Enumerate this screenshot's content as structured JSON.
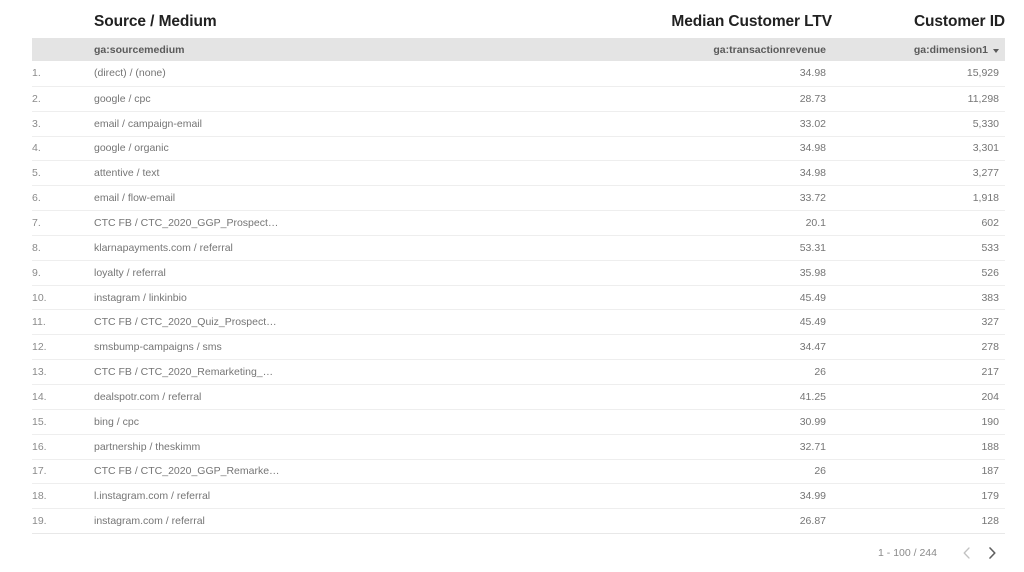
{
  "table": {
    "columns": [
      {
        "title": "",
        "field": ""
      },
      {
        "title": "Source / Medium",
        "field": "ga:sourcemedium"
      },
      {
        "title": "Median Customer LTV",
        "field": "ga:transactionrevenue"
      },
      {
        "title": "Customer ID",
        "field": "ga:dimension1"
      }
    ],
    "sorted_column_index": 3,
    "sort_icon": "caret-down-icon",
    "rows": [
      {
        "index": "1.",
        "source_medium": "(direct) / (none)",
        "median_ltv": "34.98",
        "customer_id": "15,929"
      },
      {
        "index": "2.",
        "source_medium": "google / cpc",
        "median_ltv": "28.73",
        "customer_id": "11,298"
      },
      {
        "index": "3.",
        "source_medium": "email / campaign-email",
        "median_ltv": "33.02",
        "customer_id": "5,330"
      },
      {
        "index": "4.",
        "source_medium": "google / organic",
        "median_ltv": "34.98",
        "customer_id": "3,301"
      },
      {
        "index": "5.",
        "source_medium": "attentive / text",
        "median_ltv": "34.98",
        "customer_id": "3,277"
      },
      {
        "index": "6.",
        "source_medium": "email / flow-email",
        "median_ltv": "33.72",
        "customer_id": "1,918"
      },
      {
        "index": "7.",
        "source_medium": "CTC FB / CTC_2020_GGP_Prospect…",
        "median_ltv": "20.1",
        "customer_id": "602"
      },
      {
        "index": "8.",
        "source_medium": "klarnapayments.com / referral",
        "median_ltv": "53.31",
        "customer_id": "533"
      },
      {
        "index": "9.",
        "source_medium": "loyalty / referral",
        "median_ltv": "35.98",
        "customer_id": "526"
      },
      {
        "index": "10.",
        "source_medium": "instagram / linkinbio",
        "median_ltv": "45.49",
        "customer_id": "383"
      },
      {
        "index": "11.",
        "source_medium": "CTC FB / CTC_2020_Quiz_Prospect…",
        "median_ltv": "45.49",
        "customer_id": "327"
      },
      {
        "index": "12.",
        "source_medium": "smsbump-campaigns / sms",
        "median_ltv": "34.47",
        "customer_id": "278"
      },
      {
        "index": "13.",
        "source_medium": "CTC FB / CTC_2020_Remarketing_…",
        "median_ltv": "26",
        "customer_id": "217"
      },
      {
        "index": "14.",
        "source_medium": "dealspotr.com / referral",
        "median_ltv": "41.25",
        "customer_id": "204"
      },
      {
        "index": "15.",
        "source_medium": "bing / cpc",
        "median_ltv": "30.99",
        "customer_id": "190"
      },
      {
        "index": "16.",
        "source_medium": "partnership / theskimm",
        "median_ltv": "32.71",
        "customer_id": "188"
      },
      {
        "index": "17.",
        "source_medium": "CTC FB / CTC_2020_GGP_Remarke…",
        "median_ltv": "26",
        "customer_id": "187"
      },
      {
        "index": "18.",
        "source_medium": "l.instagram.com / referral",
        "median_ltv": "34.99",
        "customer_id": "179"
      },
      {
        "index": "19.",
        "source_medium": "instagram.com / referral",
        "median_ltv": "26.87",
        "customer_id": "128"
      }
    ]
  },
  "pagination": {
    "range_label": "1 - 100 / 244",
    "prev_icon": "chevron-left-icon",
    "next_icon": "chevron-right-icon"
  },
  "colors": {
    "field_row_background": "#e4e4e4",
    "row_divider": "#eeeeee",
    "title_text": "#212121",
    "body_text": "#757575",
    "page_background": "#ffffff"
  }
}
